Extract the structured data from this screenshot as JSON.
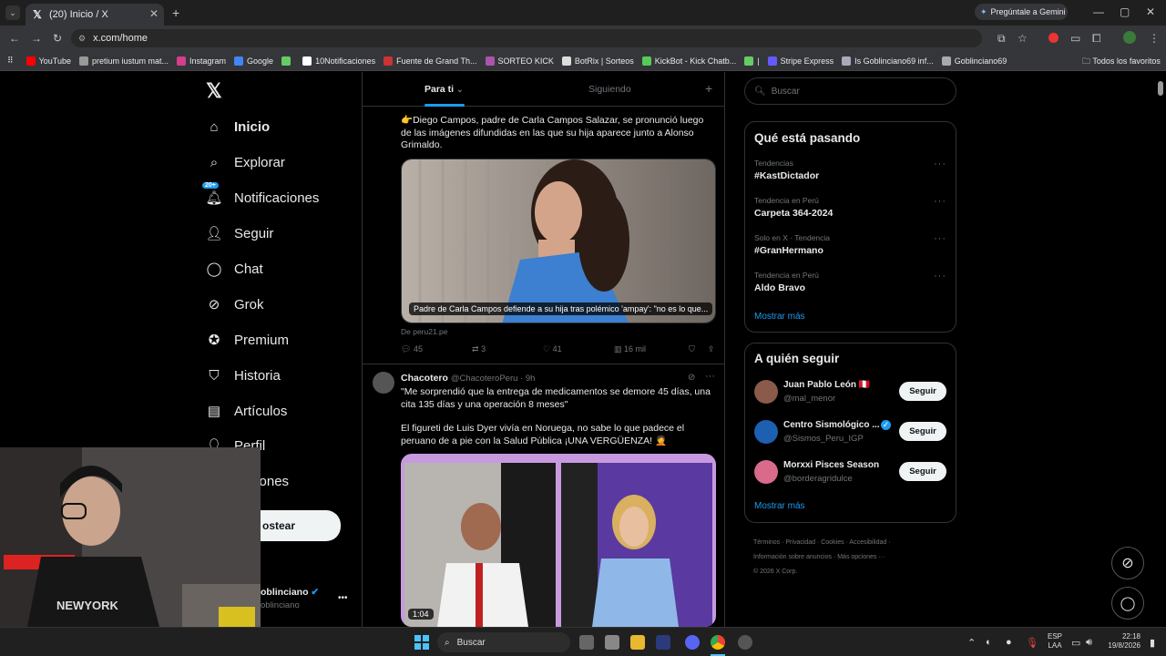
{
  "browser": {
    "tab_title": "(20) Inicio / X",
    "new_tab": "+",
    "gemini_button": "Pregúntale a Gemini",
    "url": "x.com/home",
    "bookmarks": [
      "YouTube",
      "pretium iustum mat...",
      "Instagram",
      "Google",
      "",
      "10Notificaciones",
      "Fuente de Grand Th...",
      "SORTEO KICK",
      "BotRix | Sorteos",
      "KickBot - Kick Chatb...",
      "|",
      "Stripe Express",
      "Is Goblinciano69 inf...",
      "Goblinciano69"
    ],
    "all_bookmarks": "Todos los favoritos"
  },
  "sidebar": {
    "items": [
      {
        "label": "Inicio",
        "icon": "home-icon"
      },
      {
        "label": "Explorar",
        "icon": "search-icon"
      },
      {
        "label": "Notificaciones",
        "icon": "bell-icon",
        "badge": "20+"
      },
      {
        "label": "Seguir",
        "icon": "add-user-icon"
      },
      {
        "label": "Chat",
        "icon": "chat-icon"
      },
      {
        "label": "Grok",
        "icon": "grok-icon"
      },
      {
        "label": "Premium",
        "icon": "verified-icon"
      },
      {
        "label": "Historia",
        "icon": "bookmark-icon"
      },
      {
        "label": "Artículos",
        "icon": "articles-icon"
      },
      {
        "label": "Perfil",
        "icon": "person-icon"
      },
      {
        "label": "opciones",
        "icon": "more-icon"
      }
    ],
    "post_button": "ostear",
    "account_name": "oblinciano",
    "account_handle": "oblinciano",
    "account_more": "•••"
  },
  "feed": {
    "tabs": [
      "Para ti",
      "Siguiendo"
    ],
    "tweet1": {
      "text": "👉Diego Campos, padre de Carla Campos Salazar, se pronunció luego de las imágenes difundidas en las que su hija aparece junto a Alonso Grimaldo.",
      "card_caption": "Padre de Carla Campos defiende a su hija tras polémico 'ampay': \"no es lo que...",
      "source": "De peru21.pe",
      "replies": "45",
      "reposts": "3",
      "likes": "41",
      "views": "16 mil"
    },
    "tweet2": {
      "name": "Chacotero",
      "handle": "@ChacoteroPeru · 9h",
      "text1": "\"Me sorprendió que la entrega de medicamentos se demore 45 días, una cita 135 días y una operación 8 meses\"",
      "text2": "El figureti de Luis Dyer vivía en Noruega, no sabe lo que padece el peruano de a pie con la Salud Pública ¡UNA VERGÜENZA! 🤦",
      "video_time": "1:04"
    }
  },
  "right": {
    "search_placeholder": "Buscar",
    "trends_title": "Qué está pasando",
    "trends": [
      {
        "context": "Tendencias",
        "name": "#KastDictador"
      },
      {
        "context": "Tendencia en Perú",
        "name": "Carpeta 364-2024"
      },
      {
        "context": "Solo en X · Tendencia",
        "name": "#GranHermano"
      },
      {
        "context": "Tendencia en Perú",
        "name": "Aldo Bravo"
      }
    ],
    "show_more": "Mostrar más",
    "follow_title": "A quién seguir",
    "follows": [
      {
        "name": "Juan Pablo León 🇵🇪",
        "handle": "@mal_menor",
        "button": "Seguir",
        "color": "#8a5a4a"
      },
      {
        "name": "Centro Sismológico ...",
        "handle": "@Sismos_Peru_IGP",
        "button": "Seguir",
        "color": "#1d5fb0"
      },
      {
        "name": "Morxxi Pisces Season",
        "handle": "@borderagridulce",
        "button": "Seguir",
        "color": "#d86a8a"
      }
    ],
    "follow_more": "Mostrar más",
    "footer1": "Términos · Privacidad · Cookies · Accesibilidad ·",
    "footer2": "Información sobre anuncios · Más opciones ···",
    "footer3": "© 2026 X Corp."
  },
  "taskbar": {
    "search": "Buscar",
    "lang1": "ESP",
    "lang2": "LAA",
    "time": "22:18",
    "date": "19/8/2026"
  }
}
